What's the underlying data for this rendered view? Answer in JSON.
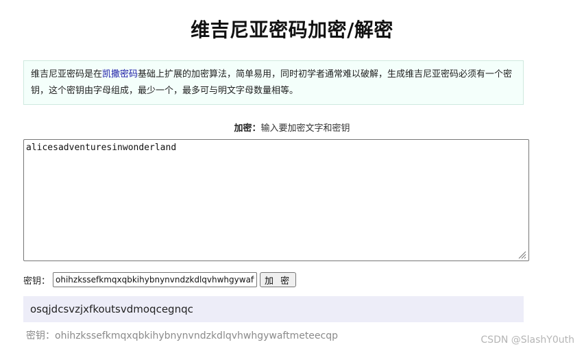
{
  "title": "维吉尼亚密码加密/解密",
  "intro": {
    "before_link": "维吉尼亚密码是在",
    "link": "凯撒密码",
    "after_link": "基础上扩展的加密算法，简单易用，同时初学者通常难以破解，生成维吉尼亚密码必须有一个密钥，这个密钥由字母组成，最少一个，最多可与明文字母数量相等。"
  },
  "encrypt": {
    "label_bold": "加密：",
    "label_text": "输入要加密文字和密钥",
    "plaintext": "alicesadventuresinwonderland"
  },
  "key": {
    "label": "密钥：",
    "value": "ohihzkssefkmqxqbkihybnynvndzkdlqvhwhgywaftmeteecqp",
    "button_label": "加 密"
  },
  "result": {
    "ciphertext": "osqjdcsvzjxfkoutsvdmoqcegnqc",
    "key_echo": "密钥：ohihzkssefkmqxqbkihybnynvndzkdlqvhwhgywaftmeteecqp"
  },
  "watermark": "CSDN @SlashY0uth"
}
